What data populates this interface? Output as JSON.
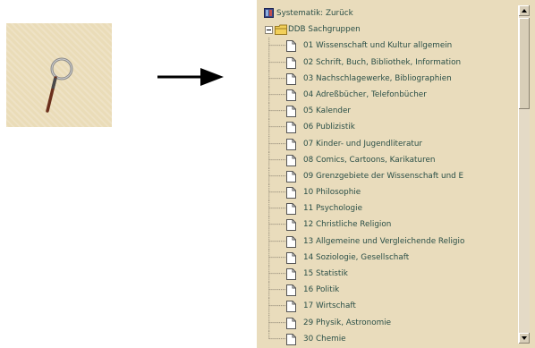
{
  "tree": {
    "header": "Systematik:  Zurück",
    "group": "DDB Sachgruppen",
    "items": [
      "01 Wissenschaft und Kultur allgemein",
      "02 Schrift, Buch, Bibliothek, Information",
      "03 Nachschlagewerke, Bibliographien",
      "04 Adreßbücher, Telefonbücher",
      "05 Kalender",
      "06 Publizistik",
      "07 Kinder- und Jugendliteratur",
      "08 Comics, Cartoons, Karikaturen",
      "09 Grenzgebiete der Wissenschaft und E",
      "10 Philosophie",
      "11 Psychologie",
      "12 Christliche Religion",
      "13 Allgemeine und Vergleichende Religio",
      "14 Soziologie, Gesellschaft",
      "15 Statistik",
      "16 Politik",
      "17 Wirtschaft",
      "29 Physik, Astronomie",
      "30 Chemie"
    ]
  },
  "colors": {
    "panel_bg": "#e9dcbc",
    "text": "#2a4f47",
    "tile_bg": "#eadcb8",
    "arrow": "#000000"
  },
  "icons": {
    "search_tile": "magnifier-icon",
    "arrow": "arrow-right-icon",
    "header": "book-icon",
    "group": "folder-open-icon",
    "item": "document-icon"
  }
}
